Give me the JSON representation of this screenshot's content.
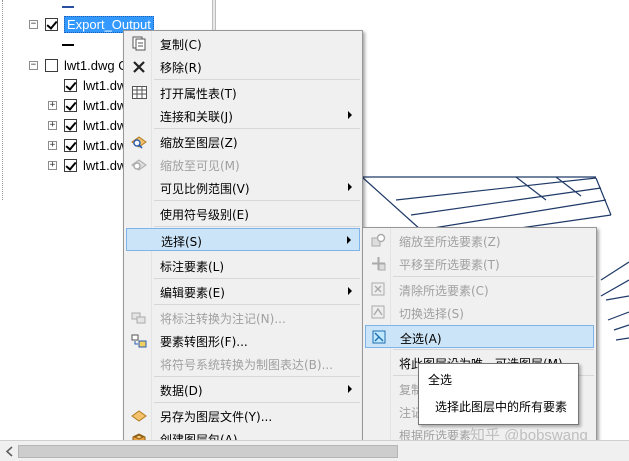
{
  "toc": {
    "layer_export": "Export_Output",
    "layer_dwg": "lwt1.dwg G",
    "sublayers": [
      "lwt1.dw",
      "lwt1.dw",
      "lwt1.dw",
      "lwt1.dw",
      "lwt1.dw"
    ]
  },
  "menu_main": {
    "items": [
      {
        "label": "复制(C)",
        "icon": "copy-icon",
        "enabled": true
      },
      {
        "label": "移除(R)",
        "icon": "remove-x-icon",
        "enabled": true
      },
      {
        "label": "打开属性表(T)",
        "icon": "table-icon",
        "enabled": true
      },
      {
        "label": "连接和关联(J)",
        "icon": "",
        "enabled": true,
        "submenu": true
      },
      {
        "label": "缩放至图层(Z)",
        "icon": "zoom-to-layer-icon",
        "enabled": true
      },
      {
        "label": "缩放至可见(M)",
        "icon": "zoom-to-visible-icon",
        "enabled": false
      },
      {
        "label": "可见比例范围(V)",
        "icon": "",
        "enabled": true,
        "submenu": true
      },
      {
        "label": "使用符号级别(E)",
        "icon": "",
        "enabled": true
      },
      {
        "label": "选择(S)",
        "icon": "",
        "enabled": true,
        "submenu": true,
        "highlighted": true
      },
      {
        "label": "标注要素(L)",
        "icon": "",
        "enabled": true
      },
      {
        "label": "编辑要素(E)",
        "icon": "",
        "enabled": true,
        "submenu": true
      },
      {
        "label": "将标注转换为注记(N)...",
        "icon": "convert-labels-icon",
        "enabled": false
      },
      {
        "label": "要素转图形(F)...",
        "icon": "features-to-graphics-icon",
        "enabled": true
      },
      {
        "label": "将符号系统转换为制图表达(B)...",
        "icon": "",
        "enabled": false
      },
      {
        "label": "数据(D)",
        "icon": "",
        "enabled": true,
        "submenu": true
      },
      {
        "label": "另存为图层文件(Y)...",
        "icon": "layer-file-icon",
        "enabled": true
      },
      {
        "label": "创建图层包(A)...",
        "icon": "layer-package-icon",
        "enabled": true
      }
    ]
  },
  "menu_select": {
    "items": [
      {
        "label": "缩放至所选要素(Z)",
        "icon": "zoom-selected-icon",
        "enabled": false
      },
      {
        "label": "平移至所选要素(T)",
        "icon": "pan-selected-icon",
        "enabled": false
      },
      {
        "label": "清除所选要素(C)",
        "icon": "clear-selection-icon",
        "enabled": false
      },
      {
        "label": "切换选择(S)",
        "icon": "switch-selection-icon",
        "enabled": false
      },
      {
        "label": "全选(A)",
        "icon": "select-all-icon",
        "enabled": true,
        "highlighted": true
      },
      {
        "label": "将此图层设为唯一可选图层(M)",
        "icon": "",
        "enabled": true
      },
      {
        "label": "复制",
        "icon": "",
        "enabled": false
      },
      {
        "label": "注记",
        "icon": "",
        "enabled": false
      },
      {
        "label": "根据所选要素",
        "icon": "",
        "enabled": false
      }
    ]
  },
  "tooltip": {
    "title": "全选",
    "description": "选择此图层中的所有要素"
  },
  "watermark": "知乎 @bobswang",
  "colors": {
    "selection_blue": "#3399ff",
    "menu_highlight": "#cce4f7",
    "map_line": "#1f3a68"
  }
}
